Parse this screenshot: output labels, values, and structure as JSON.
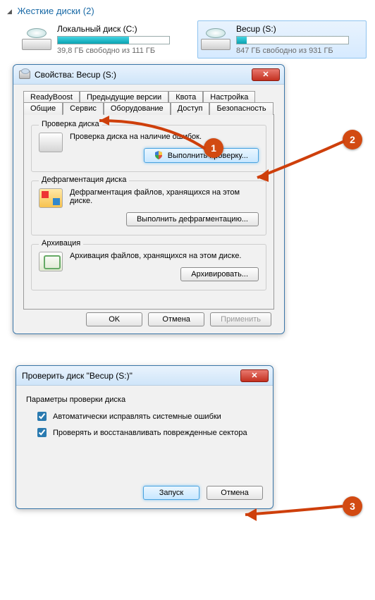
{
  "explorer": {
    "section_title": "Жесткие диски (2)",
    "drives": [
      {
        "name": "Локальный диск (C:)",
        "free_text": "39,8 ГБ свободно из 111 ГБ",
        "fill_pct": 64
      },
      {
        "name": "Becup (S:)",
        "free_text": "847 ГБ свободно из 931 ГБ",
        "fill_pct": 9
      }
    ]
  },
  "properties_dialog": {
    "title": "Свойства: Becup (S:)",
    "tabs_row1": [
      "ReadyBoost",
      "Предыдущие версии",
      "Квота",
      "Настройка"
    ],
    "tabs_row2": [
      "Общие",
      "Сервис",
      "Оборудование",
      "Доступ",
      "Безопасность"
    ],
    "active_tab": "Сервис",
    "groups": {
      "check": {
        "legend": "Проверка диска",
        "desc": "Проверка диска на наличие ошибок.",
        "button": "Выполнить проверку..."
      },
      "defrag": {
        "legend": "Дефрагментация диска",
        "desc": "Дефрагментация файлов, хранящихся на этом диске.",
        "button": "Выполнить дефрагментацию..."
      },
      "backup": {
        "legend": "Архивация",
        "desc": "Архивация файлов, хранящихся на этом диске.",
        "button": "Архивировать..."
      }
    },
    "footer": {
      "ok": "OK",
      "cancel": "Отмена",
      "apply": "Применить"
    }
  },
  "checkdisk_dialog": {
    "title": "Проверить диск \"Becup (S:)\"",
    "params_label": "Параметры проверки диска",
    "option1": "Автоматически исправлять системные ошибки",
    "option2": "Проверять и восстанавливать поврежденные сектора",
    "start": "Запуск",
    "cancel": "Отмена"
  },
  "callouts": {
    "c1": "1",
    "c2": "2",
    "c3": "3"
  }
}
